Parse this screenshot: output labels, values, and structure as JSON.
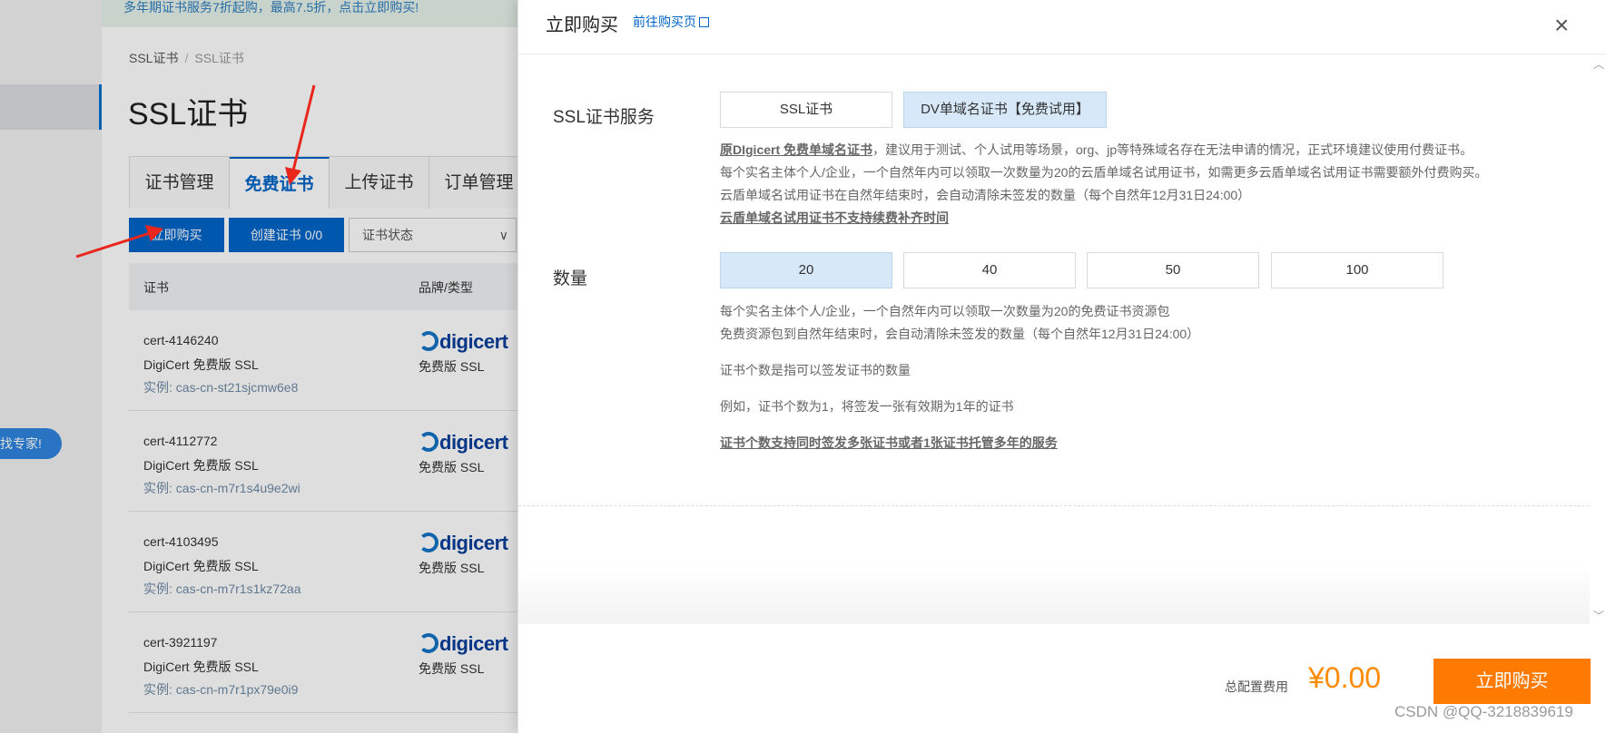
{
  "console": {
    "expert_badge": "找专家!",
    "collapse_icon": "‹",
    "banner": "多年期证书服务7折起购，最高7.5折，点击立即购买!",
    "breadcrumb": [
      "SSL证书",
      "SSL证书"
    ],
    "page_title": "SSL证书",
    "tabs": [
      {
        "label": "证书管理"
      },
      {
        "label": "免费证书"
      },
      {
        "label": "上传证书"
      },
      {
        "label": "订单管理"
      }
    ],
    "active_tab": "免费证书",
    "buy_button": "立即购买",
    "create_button": "创建证书 0/0",
    "status_select": "证书状态",
    "table_headers": [
      "证书",
      "品牌/类型"
    ],
    "rows": [
      {
        "id": "cert-4146240",
        "name": "DigiCert 免费版 SSL",
        "instance": "实例: cas-cn-st21sjcmw6e8",
        "brand": "digicert",
        "type": "免费版 SSL"
      },
      {
        "id": "cert-4112772",
        "name": "DigiCert 免费版 SSL",
        "instance": "实例: cas-cn-m7r1s4u9e2wi",
        "brand": "digicert",
        "type": "免费版 SSL"
      },
      {
        "id": "cert-4103495",
        "name": "DigiCert 免费版 SSL",
        "instance": "实例: cas-cn-m7r1s1kz72aa",
        "brand": "digicert",
        "type": "免费版 SSL"
      },
      {
        "id": "cert-3921197",
        "name": "DigiCert 免费版 SSL",
        "instance": "实例: cas-cn-m7r1px79e0i9",
        "brand": "digicert",
        "type": "免费版 SSL"
      }
    ]
  },
  "drawer": {
    "title": "立即购买",
    "link": "前往购买页",
    "link_icon": "external-link-icon",
    "close_icon": "×",
    "service_label": "SSL证书服务",
    "service_options": [
      "SSL证书",
      "DV单域名证书【免费试用】"
    ],
    "service_selected": "DV单域名证书【免费试用】",
    "service_help": {
      "bold_prefix": "原DIgicert 免费单域名证书",
      "line1_rest": "，建议用于测试、个人试用等场景，org、jp等特殊域名存在无法申请的情况，正式环境建议使用付费证书。",
      "line2": "每个实名主体个人/企业，一个自然年内可以领取一次数量为20的云盾单域名试用证书，如需更多云盾单域名试用证书需要额外付费购买。",
      "line3": "云盾单域名试用证书在自然年结束时，会自动清除未签发的数量（每个自然年12月31日24:00）",
      "line4": "云盾单域名试用证书不支持续费补齐时间"
    },
    "qty_label": "数量",
    "qty_options": [
      "20",
      "40",
      "50",
      "100"
    ],
    "qty_selected": "20",
    "qty_help": {
      "line1": "每个实名主体个人/企业，一个自然年内可以领取一次数量为20的免费证书资源包",
      "line2": "免费资源包到自然年结束时，会自动清除未签发的数量（每个自然年12月31日24:00）",
      "line3": "证书个数是指可以签发证书的数量",
      "line4": "例如，证书个数为1，将签发一张有效期为1年的证书",
      "line5": "证书个数支持同时签发多张证书或者1张证书托管多年的服务"
    },
    "total_label": "总配置费用",
    "total_price": "¥0.00",
    "buy_now": "立即购买"
  },
  "watermark": "CSDN @QQ-3218839619",
  "colors": {
    "primary": "#0064c8",
    "accent_orange": "#ff7a00",
    "price": "#ff8a00",
    "arrow_red": "#e8261c",
    "selected_option": "#d7e9f9"
  }
}
